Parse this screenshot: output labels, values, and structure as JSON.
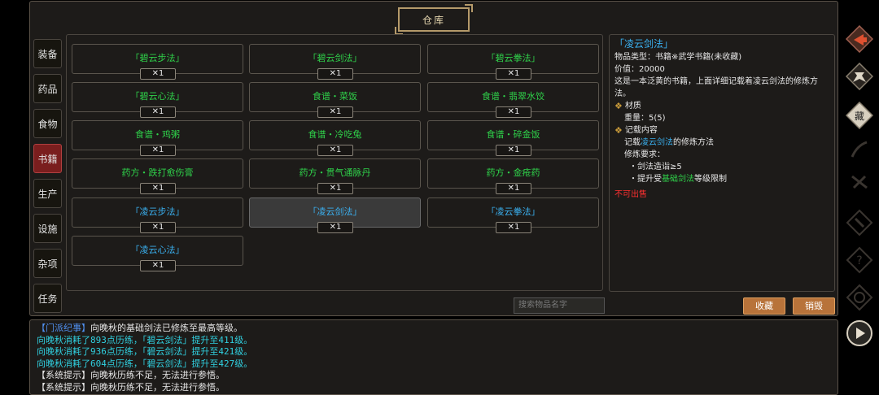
{
  "title": "仓库",
  "categories": [
    "装备",
    "药品",
    "食物",
    "书籍",
    "生产",
    "设施",
    "杂项",
    "任务"
  ],
  "active_category": 3,
  "items": [
    {
      "name": "「碧云步法」",
      "count": "✕1",
      "color": "#2fd24a"
    },
    {
      "name": "「碧云剑法」",
      "count": "✕1",
      "color": "#2fd24a"
    },
    {
      "name": "「碧云拳法」",
      "count": "✕1",
      "color": "#2fd24a"
    },
    {
      "name": "「碧云心法」",
      "count": "✕1",
      "color": "#2fd24a"
    },
    {
      "name": "食谱・菜饭",
      "count": "✕1",
      "color": "#2fd24a"
    },
    {
      "name": "食谱・翡翠水饺",
      "count": "✕1",
      "color": "#2fd24a"
    },
    {
      "name": "食谱・鸡粥",
      "count": "✕1",
      "color": "#2fd24a"
    },
    {
      "name": "食谱・冷吃兔",
      "count": "✕1",
      "color": "#2fd24a"
    },
    {
      "name": "食谱・碎金饭",
      "count": "✕1",
      "color": "#2fd24a"
    },
    {
      "name": "药方・跌打愈伤膏",
      "count": "✕1",
      "color": "#2fd24a"
    },
    {
      "name": "药方・贯气通脉丹",
      "count": "✕1",
      "color": "#2fd24a"
    },
    {
      "name": "药方・金疮药",
      "count": "✕1",
      "color": "#2fd24a"
    },
    {
      "name": "「凌云步法」",
      "count": "✕1",
      "color": "#3ab0f0"
    },
    {
      "name": "「凌云剑法」",
      "count": "✕1",
      "color": "#3ab0f0",
      "selected": true
    },
    {
      "name": "「凌云拳法」",
      "count": "✕1",
      "color": "#3ab0f0"
    },
    {
      "name": "「凌云心法」",
      "count": "✕1",
      "color": "#3ab0f0"
    }
  ],
  "detail": {
    "title": "「凌云剑法」",
    "type": "物品类型：书籍※武学书籍(未收藏)",
    "price": "价值：20000",
    "desc": "这是一本泛黄的书籍，上面详细记载着凌云剑法的修炼方法。",
    "material_head": "材质",
    "weight": "重量：5(5)",
    "content_head": "记载内容",
    "record_prefix": "记载",
    "record_link": "凌云剑法",
    "record_suffix": "的修炼方法",
    "req_head": "修炼要求：",
    "req1": "・剑法造诣≥5",
    "req2_prefix": "・提升受",
    "req2_link": "基础剑法",
    "req2_suffix": "等级限制",
    "no_sell": "不可出售"
  },
  "search_placeholder": "搜索物品名字",
  "collect_label": "收藏",
  "destroy_label": "销毁",
  "log": [
    {
      "style": "white",
      "tag": "【门派纪事】",
      "text": "向晚秋的基础剑法已修炼至最高等级。"
    },
    {
      "style": "cyan",
      "text": "向晚秋消耗了893点历练，「碧云剑法」提升至411级。"
    },
    {
      "style": "cyan",
      "text": "向晚秋消耗了936点历练，「碧云剑法」提升至421级。"
    },
    {
      "style": "cyan",
      "text": "向晚秋消耗了604点历练，「碧云剑法」提升至427级。"
    },
    {
      "style": "white",
      "text": "【系统提示】向晚秋历练不足，无法进行参悟。"
    },
    {
      "style": "white",
      "text": "【系统提示】向晚秋历练不足，无法进行参悟。"
    }
  ],
  "colors": {
    "accent": "#b8733a",
    "active_tab": "#7a1e1e",
    "blue": "#3ab0f0",
    "green": "#2fd24a",
    "red": "#ff3030"
  }
}
